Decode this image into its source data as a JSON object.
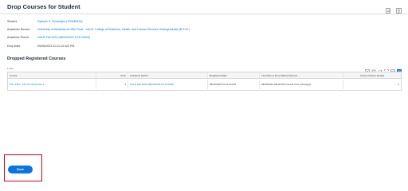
{
  "header": {
    "title": "Drop Courses for Student",
    "icons": [
      "export-pdf-icon",
      "configure-icon"
    ]
  },
  "fields": [
    {
      "label": "Student",
      "value": "Ryelynn S. Burroughs (T00445515)",
      "is_link": true
    },
    {
      "label": "Academic Record",
      "value": "University of Arkansas at Little Rock - UALR, College of Business, Health, and Human Services Undergraduate (B.S.W.)",
      "is_link": true
    },
    {
      "label": "Academic Period",
      "value": "UALR Fall 2023 (08/20/2023-12/17/2023)",
      "is_link": true
    },
    {
      "label": "Drop Date",
      "value": "09/26/2023 01:21:14.422 PM",
      "is_link": false
    }
  ],
  "section": {
    "title": "Dropped Registered Courses",
    "item_count": "1 item",
    "tool_icons": [
      "excel-export-icon",
      "filter-icon",
      "sort-icon",
      "fullscreen-icon",
      "table-view-icon",
      "grid-view-icon"
    ]
  },
  "table": {
    "columns": [
      "Course",
      "Units",
      "Academic Period",
      "Registered Date",
      "Last Date to Drop Without Record",
      "Course Section Details"
    ],
    "rows": [
      [
        "PSY 2110 - Life Of Christopher 1",
        "3",
        "UALR Fall 2023 (08/20/2023-12/17/2023)",
        "08/22/2023 01:12:53 PM",
        "08/25/2023 (09:26 PM Central Time (Chicago))",
        "1"
      ]
    ]
  },
  "actions": {
    "done_label": "Done"
  },
  "colors": {
    "accent": "#0875e1",
    "highlight_border": "#d0021b",
    "title": "#1d2d3e"
  }
}
